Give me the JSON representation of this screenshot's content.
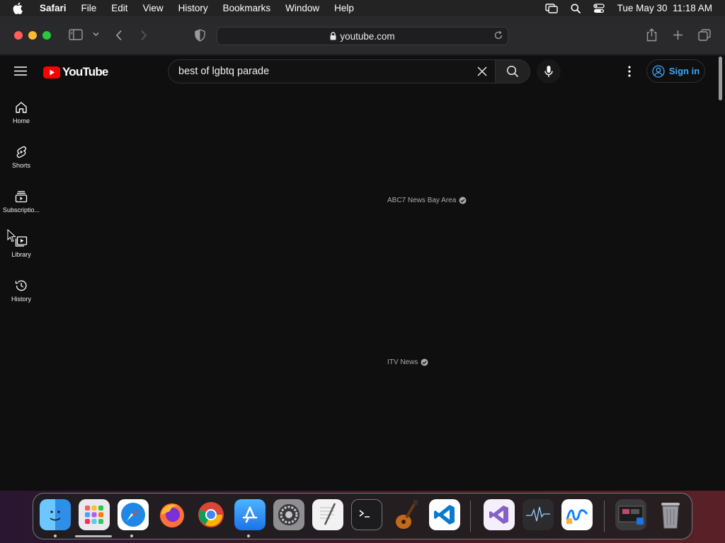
{
  "menubar": {
    "app_name": "Safari",
    "items": [
      "File",
      "Edit",
      "View",
      "History",
      "Bookmarks",
      "Window",
      "Help"
    ],
    "datetime": "Tue May 30  11:18 AM"
  },
  "browser": {
    "url": "youtube.com"
  },
  "youtube": {
    "logo_text": "YouTube",
    "search_query": "best of lgbtq parade",
    "signin_label": "Sign in",
    "sidebar": [
      {
        "label": "Home",
        "icon": "home-icon"
      },
      {
        "label": "Shorts",
        "icon": "shorts-icon"
      },
      {
        "label": "Subscriptio...",
        "icon": "subscriptions-icon"
      },
      {
        "label": "Library",
        "icon": "library-icon"
      },
      {
        "label": "History",
        "icon": "history-icon"
      }
    ],
    "results": [
      {
        "channel": "ABC7 News Bay Area",
        "verified": true
      },
      {
        "channel": "ITV News",
        "verified": true
      }
    ]
  },
  "dock": {
    "apps": [
      "Finder",
      "Launchpad",
      "Safari",
      "Firefox",
      "Chrome",
      "App Store",
      "System Preferences",
      "TextEdit",
      "Terminal",
      "GarageBand",
      "Visual Studio Code",
      "Visual Studio",
      "Activity Monitor",
      "Freeform",
      "Screenshots",
      "Trash"
    ]
  },
  "colors": {
    "youtube_red": "#ff0000",
    "link_blue": "#3ea6ff",
    "page_bg": "#0f0f0f"
  }
}
